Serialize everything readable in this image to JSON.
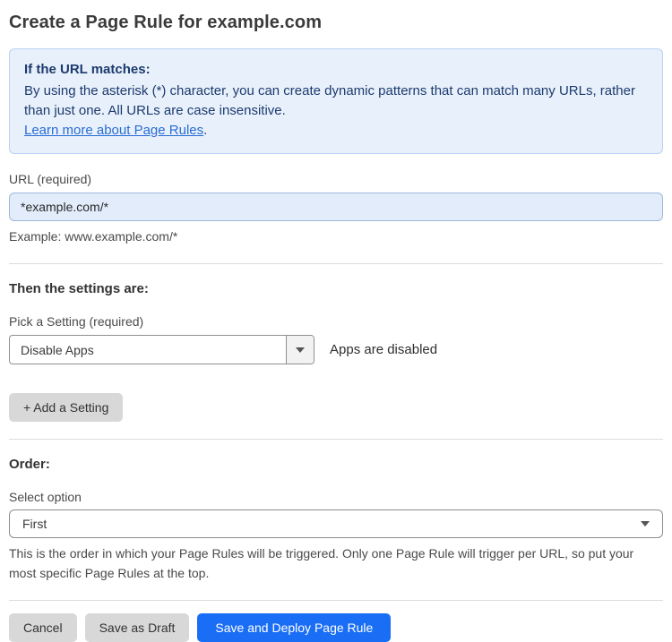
{
  "page": {
    "title": "Create a Page Rule for example.com"
  },
  "info_box": {
    "heading": "If the URL matches:",
    "body": "By using the asterisk (*) character, you can create dynamic patterns that can match many URLs, rather than just one. All URLs are case insensitive.",
    "link_text": "Learn more about Page Rules",
    "link_suffix": "."
  },
  "url_field": {
    "label": "URL (required)",
    "value": "*example.com/*",
    "helper": "Example: www.example.com/*"
  },
  "settings_section": {
    "heading": "Then the settings are:",
    "picker_label": "Pick a Setting (required)",
    "picker_value": "Disable Apps",
    "picker_status": "Apps are disabled",
    "add_setting_label": "+ Add a Setting"
  },
  "order_section": {
    "heading": "Order:",
    "select_label": "Select option",
    "select_value": "First",
    "helper": "This is the order in which your Page Rules will be triggered. Only one Page Rule will trigger per URL, so put your most specific Page Rules at the top."
  },
  "footer": {
    "cancel_label": "Cancel",
    "save_draft_label": "Save as Draft",
    "save_deploy_label": "Save and Deploy Page Rule"
  },
  "colors": {
    "accent_blue": "#1a6ef5",
    "info_box_bg": "#e8f1fb",
    "info_box_border": "#b9d3f3",
    "info_text": "#1c3a6e",
    "link_blue": "#2a6cd4",
    "url_input_bg": "#e2ecfa",
    "gray_button_bg": "#d8d8d8"
  }
}
